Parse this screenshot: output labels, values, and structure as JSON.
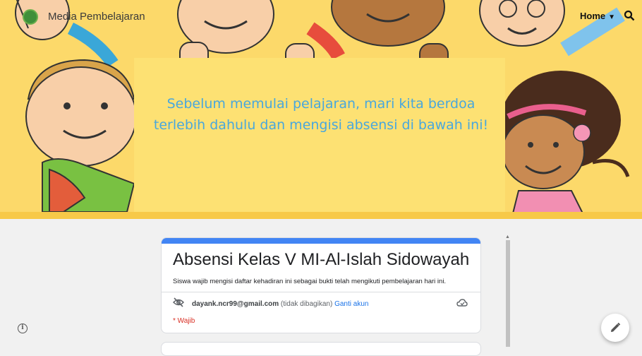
{
  "site": {
    "title": "Media Pembelajaran",
    "nav": {
      "home_label": "Home"
    },
    "icons": {
      "logo": "school-logo-icon",
      "search": "search-icon",
      "chevron": "chevron-down-icon"
    }
  },
  "banner": {
    "message": "Sebelum memulai pelajaran, mari kita berdoa terlebih dahulu dan mengisi absensi di bawah ini!",
    "colors": {
      "background": "#fcd96a",
      "panel": "#fde173",
      "text": "#49a7dd"
    }
  },
  "form": {
    "title": "Absensi Kelas V MI-Al-Islah Sidowayah",
    "description": "Siswa wajib mengisi daftar kehadiran ini sebagai bukti telah mengikuti pembelajaran hari ini.",
    "account": {
      "email": "dayank.ncr99@gmail.com",
      "note": "(tidak dibagikan)",
      "switch_label": "Ganti akun"
    },
    "required_note": "* Wajib",
    "accent_color": "#4285f4"
  },
  "footer": {
    "icons": {
      "info": "info-icon",
      "edit": "edit-pencil-icon"
    }
  }
}
